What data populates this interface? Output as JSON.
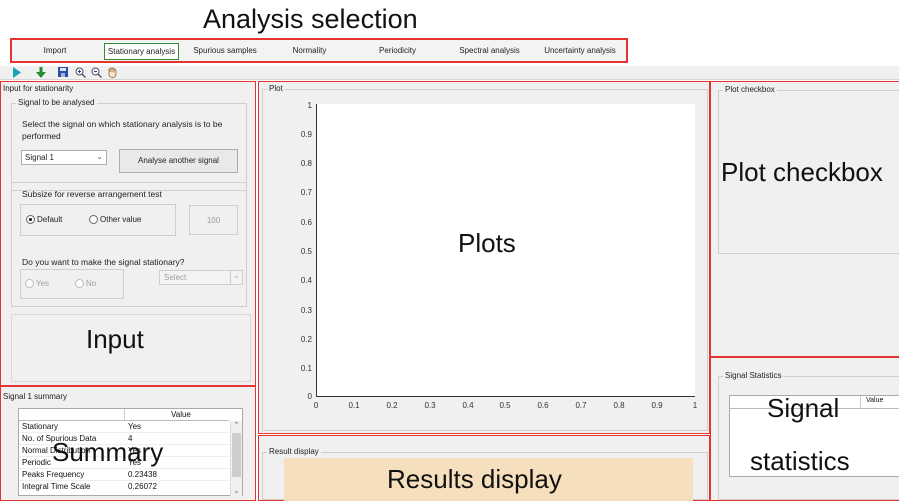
{
  "labels": {
    "analysis_selection": "Analysis selection",
    "plots": "Plots",
    "input": "Input",
    "summary": "Summary",
    "plot_checkbox": "Plot checkbox",
    "signal_statistics_1": "Signal",
    "signal_statistics_2": "statistics",
    "results_display": "Results display"
  },
  "tabs": [
    {
      "label": "Import"
    },
    {
      "label": "Stationary analysis"
    },
    {
      "label": "Spurious samples"
    },
    {
      "label": "Normality"
    },
    {
      "label": "Periodicity"
    },
    {
      "label": "Spectral analysis"
    },
    {
      "label": "Uncertainty analysis"
    }
  ],
  "toolbar": {
    "icons": [
      "play-icon",
      "download-icon",
      "save-icon",
      "zoom-in-icon",
      "zoom-out-icon",
      "pan-icon"
    ]
  },
  "input_panel": {
    "title": "Input for stationarity",
    "signal_group_title": "Signal to be analysed",
    "instruction_line1": "Select the signal on which stationary analysis is to be",
    "instruction_line2": "performed",
    "signal_select": "Signal 1",
    "analyse_button": "Analyse another signal",
    "subsize_label": "Subsize for reverse arrangement test",
    "default_label": "Default",
    "other_value_label": "Other value",
    "other_value_input": "100",
    "stationary_question": "Do you want to make the signal stationary?",
    "yes_label": "Yes",
    "no_label": "No",
    "method_select": "Select"
  },
  "summary_panel": {
    "title": "Signal 1 summary",
    "value_header": "Value",
    "rows": [
      {
        "name": "Stationary",
        "value": "Yes"
      },
      {
        "name": "No. of Spurious Data",
        "value": "4"
      },
      {
        "name": "Normal Distribution",
        "value": "Yes"
      },
      {
        "name": "Periodic",
        "value": "Yes"
      },
      {
        "name": "Peaks Frequency",
        "value": "0.23438"
      },
      {
        "name": "Integral Time Scale",
        "value": "0.26072"
      }
    ]
  },
  "plot_panel": {
    "title": "Plot",
    "y_ticks": [
      "1",
      "0.9",
      "0.8",
      "0.7",
      "0.6",
      "0.5",
      "0.4",
      "0.3",
      "0.2",
      "0.1",
      "0"
    ],
    "x_ticks": [
      "0",
      "0.1",
      "0.2",
      "0.3",
      "0.4",
      "0.5",
      "0.6",
      "0.7",
      "0.8",
      "0.9",
      "1"
    ]
  },
  "result_panel": {
    "title": "Result display"
  },
  "checkbox_panel": {
    "title": "Plot checkbox"
  },
  "stats_panel": {
    "title": "Signal Statistics",
    "value_header": "Value"
  },
  "colors": {
    "annotation_border": "#e3342f",
    "active_tab_border": "#2e8b36",
    "results_fill": "#f5dfbd"
  }
}
